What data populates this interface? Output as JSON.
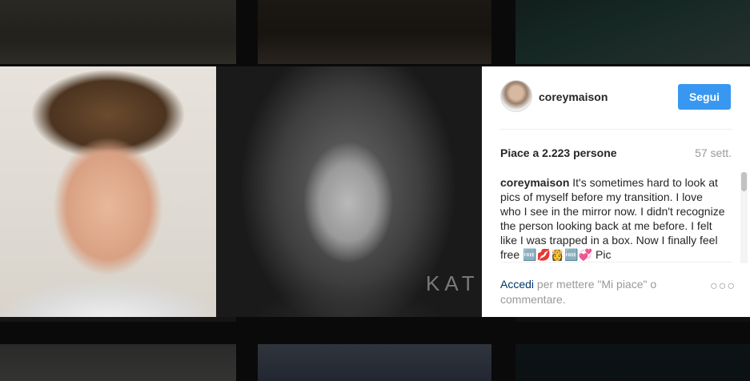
{
  "post": {
    "username": "coreymaison",
    "follow_label": "Segui",
    "likes_text": "Piace a 2.223 persone",
    "time_ago": "57 sett.",
    "caption_user": "coreymaison",
    "caption_text": " It's sometimes hard to look at pics of myself before my transition. I love who I see in the mirror now. I didn't recognize the person looking back at me before. I felt like I was trapped in a box. Now I finally feel free 🆓💋👸🆓💞 Pic",
    "photo_watermark": "KAT",
    "login_link": "Accedi",
    "login_prompt": " per mettere \"Mi piace\" o commentare."
  },
  "colors": {
    "follow_button": "#3897f0",
    "link": "#003569",
    "muted": "#999999",
    "text": "#262626"
  },
  "icons": {
    "more": "more-options-icon"
  }
}
